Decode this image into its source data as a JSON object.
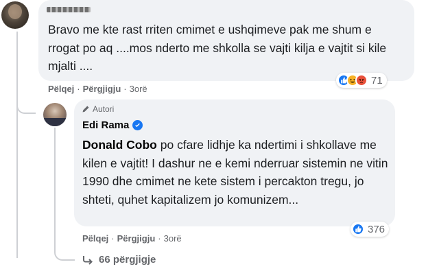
{
  "comment1": {
    "author_name": "",
    "text": "Bravo me kte rast rriten cmimet e ushqimeve pak me shum e rrogat po aq ....mos nderto me shkolla se vajti kilja e vajtit si kile mjalti ....",
    "reactions": {
      "icons": [
        "like-icon",
        "haha-icon",
        "angry-icon"
      ],
      "count": "71"
    },
    "actions": {
      "like": "Pëlqej",
      "sep1": "·",
      "reply": "Përgjigju",
      "sep2": "·",
      "time": "3orë"
    }
  },
  "reply": {
    "author_badge": "Autori",
    "author_name": "Edi Rama",
    "mention": "Donald Cobo",
    "text": " po cfare lidhje ka ndertimi i shkollave me kilen e vajtit! I dashur ne e kemi nderruar sistemin ne vitin 1990 dhe cmimet ne kete sistem i percakton tregu, jo shteti, quhet kapitalizem jo komunizem...",
    "reactions": {
      "icons": [
        "like-icon"
      ],
      "count": "376"
    },
    "actions": {
      "like": "Pëlqej",
      "sep1": "·",
      "reply": "Përgjigju",
      "sep2": "·",
      "time": "3orë"
    }
  },
  "more_replies": {
    "label": "66 përgjigje"
  },
  "colors": {
    "bubble": "#f0f2f5",
    "meta_text": "#65676b",
    "like_blue": "#1877f2",
    "haha_yellow": "#f7b125",
    "angry_red": "#e8503a"
  }
}
